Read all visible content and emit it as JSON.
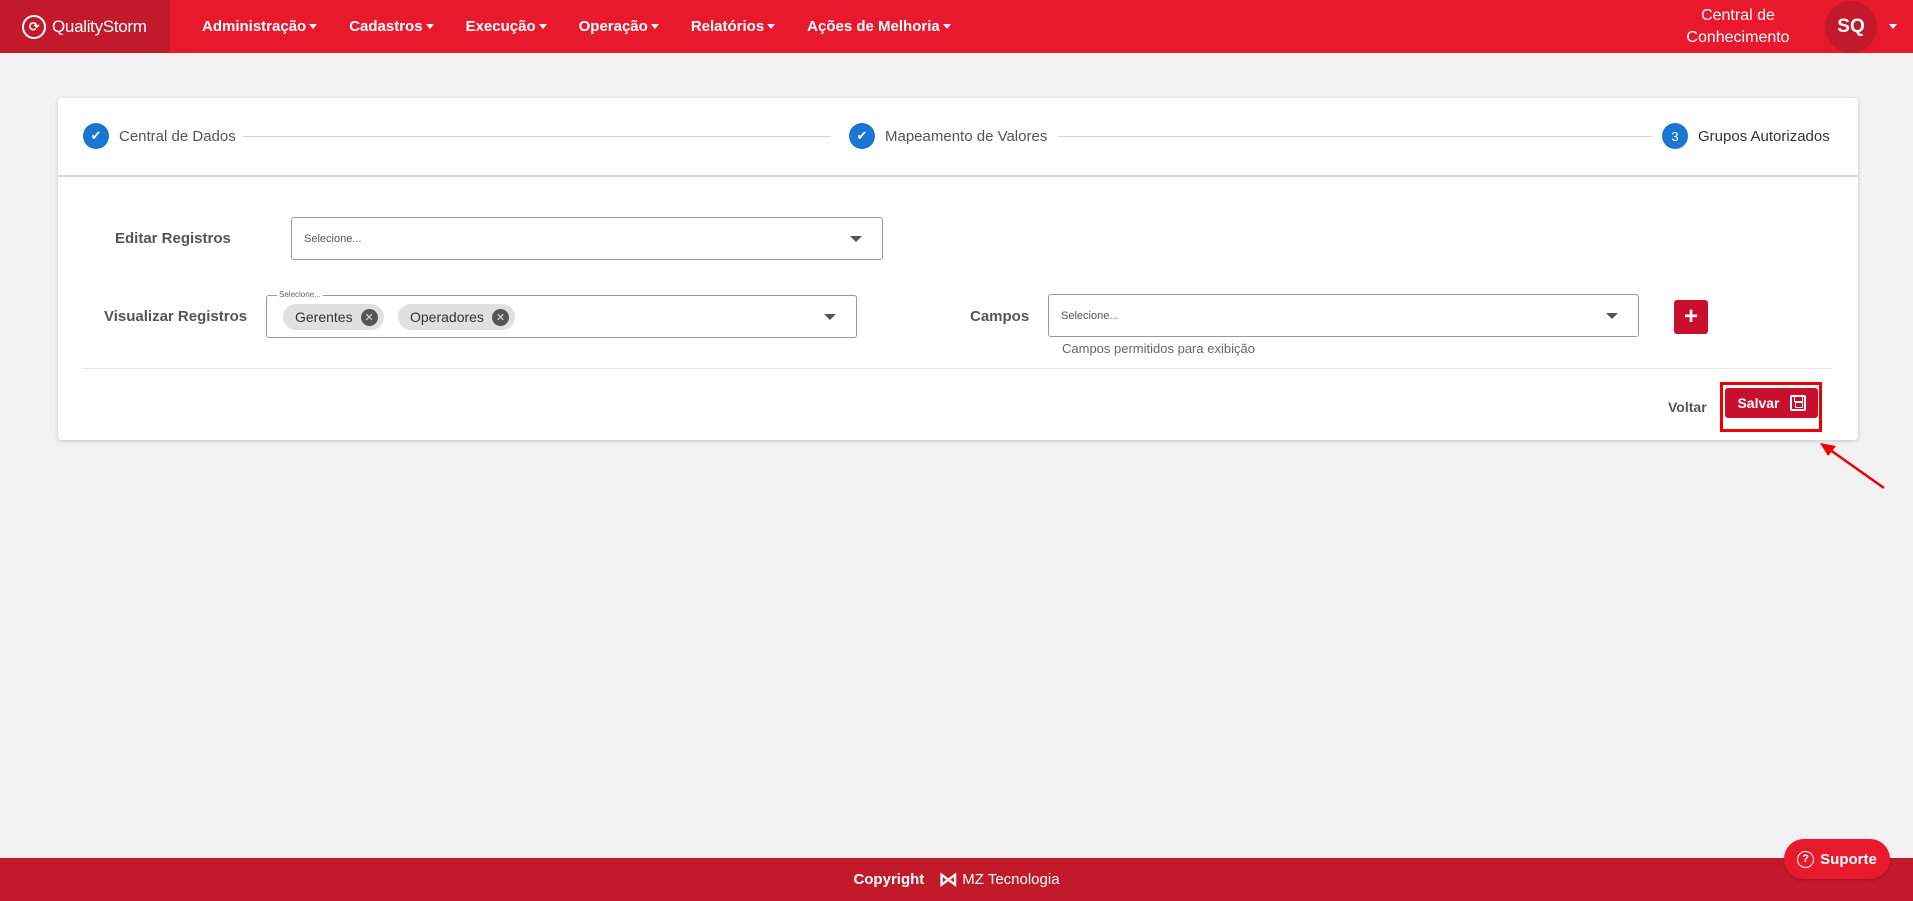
{
  "navbar": {
    "brand": "QualityStorm",
    "menu": [
      {
        "label": "Administração"
      },
      {
        "label": "Cadastros"
      },
      {
        "label": "Execução"
      },
      {
        "label": "Operação"
      },
      {
        "label": "Relatórios"
      },
      {
        "label": "Ações de Melhoria"
      }
    ],
    "knowledge_center": "Central de Conhecimento",
    "avatar_initials": "SQ"
  },
  "stepper": {
    "steps": [
      {
        "label": "Central de Dados",
        "state": "done"
      },
      {
        "label": "Mapeamento de Valores",
        "state": "done"
      },
      {
        "label": "Grupos Autorizados",
        "state": "active",
        "number": "3"
      }
    ]
  },
  "form": {
    "edit_records": {
      "label": "Editar Registros",
      "placeholder": "Selecione..."
    },
    "view_records": {
      "label": "Visualizar Registros",
      "floating_label": "Selecione...",
      "chips": [
        "Gerentes",
        "Operadores"
      ]
    },
    "fields": {
      "label": "Campos",
      "placeholder": "Selecione...",
      "helper": "Campos permitidos para exibição"
    }
  },
  "actions": {
    "back": "Voltar",
    "save": "Salvar"
  },
  "footer": {
    "copyright": "Copyright",
    "company": "MZ Tecnologia",
    "support": "Suporte"
  },
  "colors": {
    "primary": "#e8192c",
    "primary_dark": "#c21a2a",
    "step_blue": "#1976d2"
  }
}
